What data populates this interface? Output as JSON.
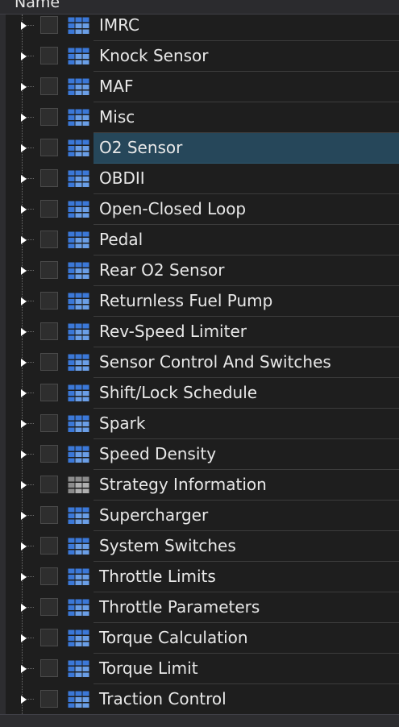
{
  "header": {
    "column_label": "Name"
  },
  "tree": {
    "items": [
      {
        "label": "IMRC",
        "icon": "table-icon",
        "selected": false
      },
      {
        "label": "Knock Sensor",
        "icon": "table-icon",
        "selected": false
      },
      {
        "label": "MAF",
        "icon": "table-icon",
        "selected": false
      },
      {
        "label": "Misc",
        "icon": "table-icon",
        "selected": false
      },
      {
        "label": "O2 Sensor",
        "icon": "table-icon",
        "selected": true
      },
      {
        "label": "OBDII",
        "icon": "table-icon",
        "selected": false
      },
      {
        "label": "Open-Closed Loop",
        "icon": "table-icon",
        "selected": false
      },
      {
        "label": "Pedal",
        "icon": "table-icon",
        "selected": false
      },
      {
        "label": "Rear O2 Sensor",
        "icon": "table-icon",
        "selected": false
      },
      {
        "label": "Returnless Fuel Pump",
        "icon": "table-icon",
        "selected": false
      },
      {
        "label": "Rev-Speed Limiter",
        "icon": "table-icon",
        "selected": false
      },
      {
        "label": "Sensor Control And Switches",
        "icon": "table-icon",
        "selected": false
      },
      {
        "label": "Shift/Lock Schedule",
        "icon": "table-icon",
        "selected": false
      },
      {
        "label": "Spark",
        "icon": "table-icon",
        "selected": false
      },
      {
        "label": "Speed Density",
        "icon": "table-icon",
        "selected": false
      },
      {
        "label": "Strategy Information",
        "icon": "table-icon-gray",
        "selected": false
      },
      {
        "label": "Supercharger",
        "icon": "table-icon",
        "selected": false
      },
      {
        "label": "System Switches",
        "icon": "table-icon",
        "selected": false
      },
      {
        "label": "Throttle Limits",
        "icon": "table-icon",
        "selected": false
      },
      {
        "label": "Throttle Parameters",
        "icon": "table-icon",
        "selected": false
      },
      {
        "label": "Torque Calculation",
        "icon": "table-icon",
        "selected": false
      },
      {
        "label": "Torque Limit",
        "icon": "table-icon",
        "selected": false
      },
      {
        "label": "Traction Control",
        "icon": "table-icon",
        "selected": false
      }
    ]
  },
  "colors": {
    "icon_blue": "#3b78d8",
    "icon_blue_light": "#6a9ee6",
    "icon_gray": "#8c8c8c",
    "icon_gray_light": "#b0b0b0",
    "selection": "#26475a"
  }
}
